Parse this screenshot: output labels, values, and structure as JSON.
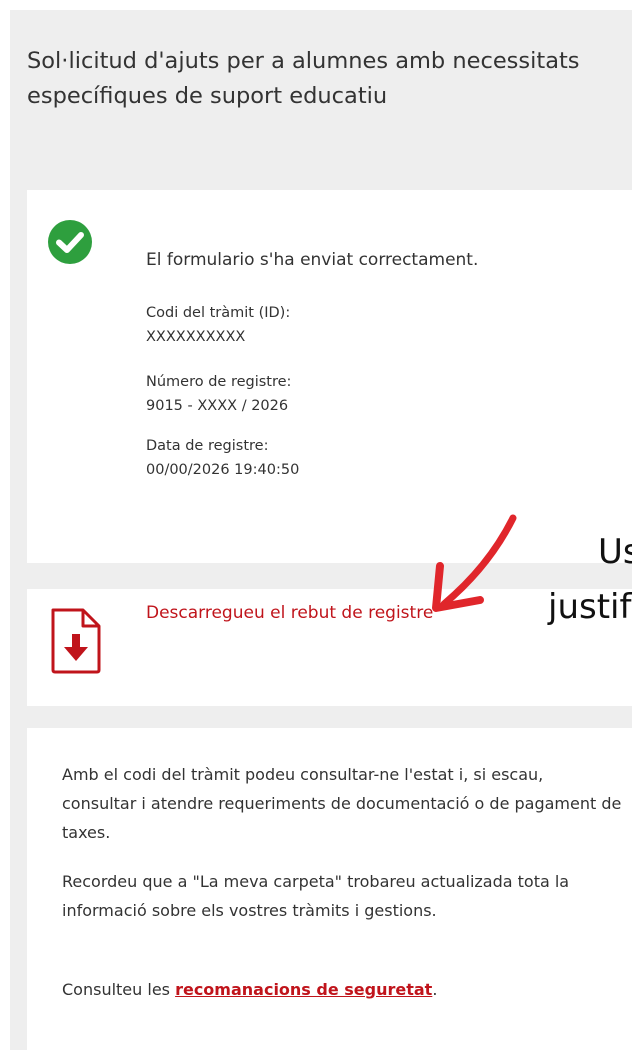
{
  "page": {
    "title": "Sol·licitud d'ajuts per a alumnes amb necessitats específiques de suport educatiu"
  },
  "confirmation": {
    "message": "El formulario s'ha enviat correctament.",
    "fields": [
      {
        "label": "Codi del tràmit (ID):",
        "value": "XXXXXXXXXX"
      },
      {
        "label": "Número de registre:",
        "value": "9015 - XXXX / 2026"
      },
      {
        "label": "Data de registre:",
        "value": "00/00/2026 19:40:50"
      }
    ],
    "icon": "check-circle-icon",
    "icon_color": "#2e9f3e"
  },
  "download": {
    "link_label": "Descarregueu el rebut de registre",
    "icon": "pdf-download-icon",
    "color": "#c0141b"
  },
  "info": {
    "paragraph_1": "Amb el codi del tràmit podeu consultar-ne l'estat i, si escau, consultar i atendre requeriments de documentació o de pagament de taxes.",
    "paragraph_2": "Recordeu que a \"La meva carpeta\" trobareu actualizada tota la informació sobre els vostres tràmits i gestions.",
    "paragraph_3_prefix": "Consulteu les ",
    "paragraph_3_link": "recomanacions de seguretat",
    "paragraph_3_suffix": "."
  },
  "overlay": {
    "line_1": "Us",
    "line_2": "justif",
    "arrow_icon": "red-arrow-icon",
    "arrow_color": "#e0262b"
  }
}
